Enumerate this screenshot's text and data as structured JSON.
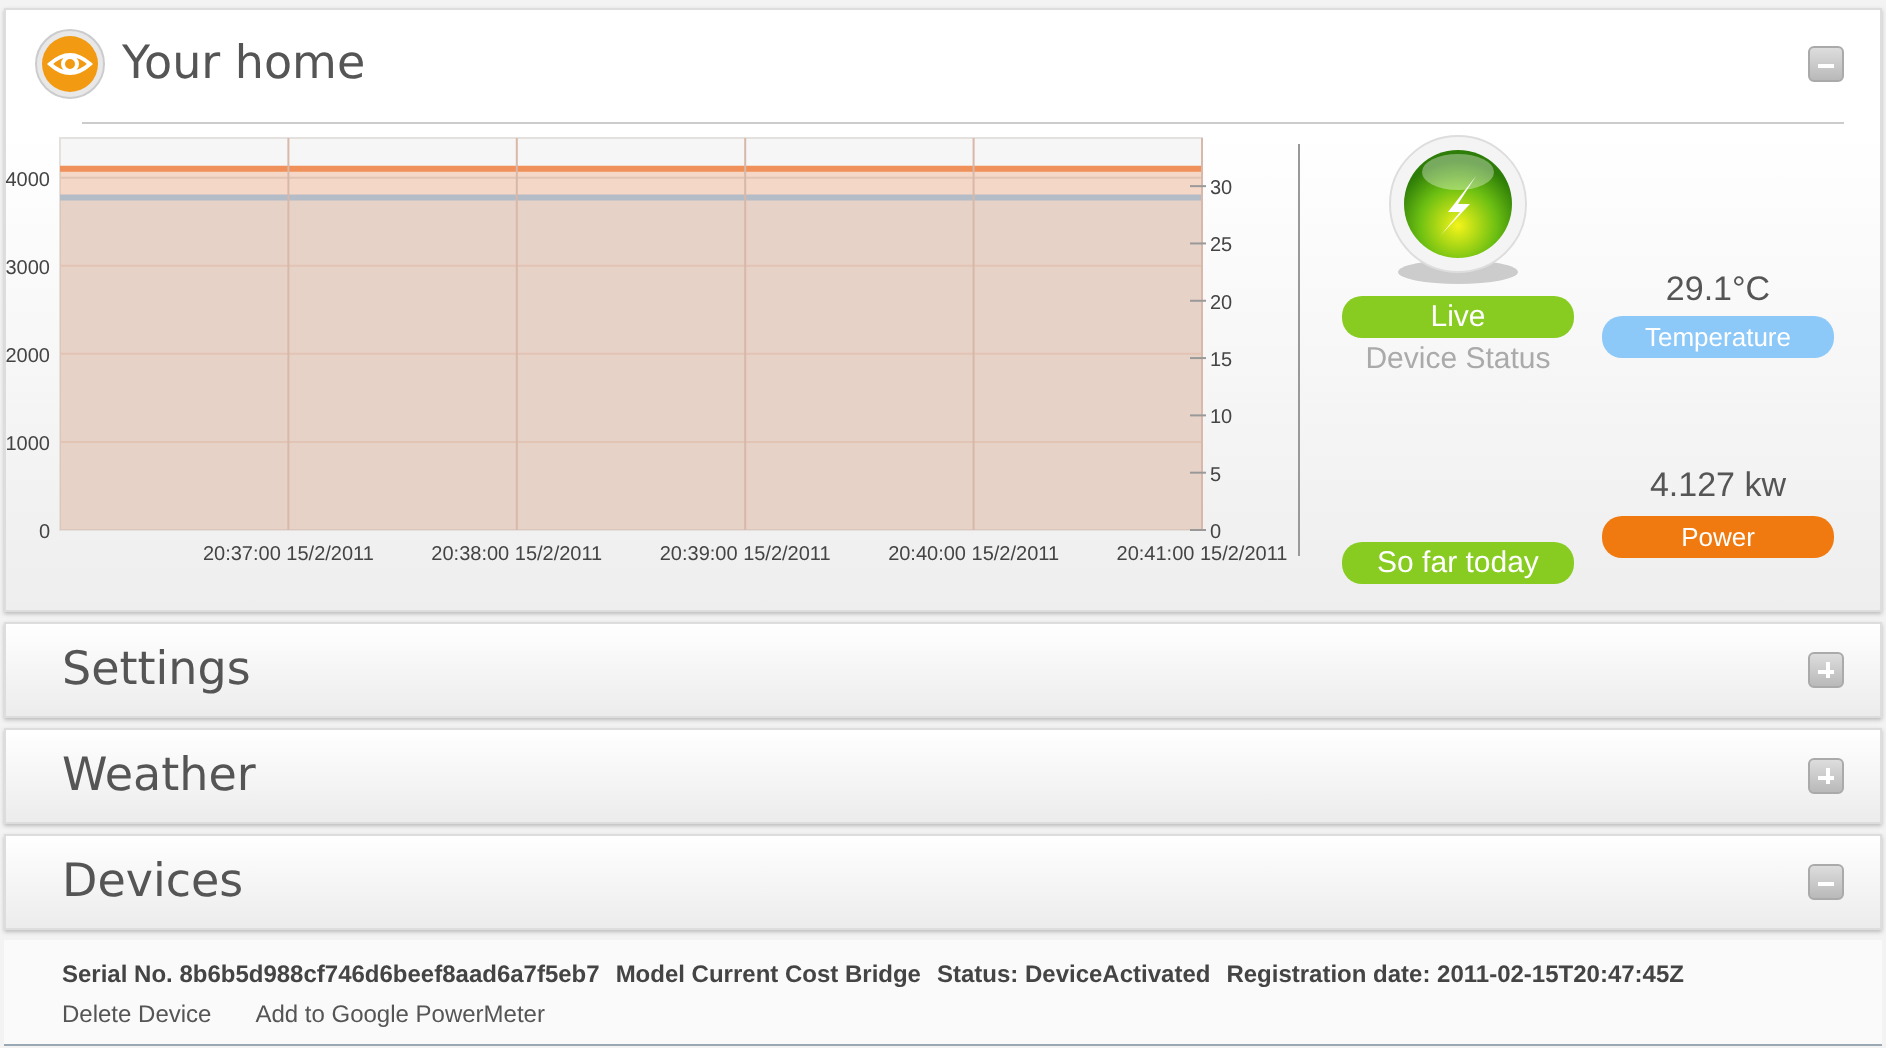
{
  "home": {
    "title": "Your home",
    "expanded": true,
    "chart_data": {
      "type": "area",
      "categories": [
        null,
        "20:37:00 15/2/2011",
        "20:38:00 15/2/2011",
        "20:39:00 15/2/2011",
        "20:40:00 15/2/2011",
        "20:41:00 15/2/2011"
      ],
      "grid": true,
      "series": [
        {
          "color": "#f0905a",
          "values": [
            4100,
            4100,
            4100,
            4100,
            4100,
            4100
          ]
        },
        {
          "color": "#b4bcc8",
          "axis": "y2",
          "values": [
            29,
            29,
            29,
            29,
            29,
            29
          ]
        }
      ],
      "ylim": [
        0,
        4450
      ],
      "yticks": [
        0,
        1000,
        2000,
        3000,
        4000
      ],
      "y2lim": [
        0,
        34.2
      ],
      "y2ticks": [
        0,
        5,
        10,
        15,
        20,
        25,
        30
      ]
    },
    "status": {
      "label": "Live",
      "caption": "Device Status"
    },
    "today": {
      "label": "So far today"
    },
    "temperature": {
      "value": "29.1°C",
      "label": "Temperature"
    },
    "power": {
      "value": "4.127 kw",
      "label": "Power"
    }
  },
  "sections": [
    {
      "title": "Settings",
      "expanded": false
    },
    {
      "title": "Weather",
      "expanded": false
    },
    {
      "title": "Devices",
      "expanded": true
    }
  ],
  "device": {
    "fields": [
      "Serial No. 8b6b5d988cf746d6beef8aad6a7f5eb7",
      "Model Current Cost Bridge",
      "Status: DeviceActivated",
      "Registration date: 2011-02-15T20:47:45Z"
    ],
    "actions": [
      "Delete Device",
      "Add to Google PowerMeter"
    ]
  }
}
